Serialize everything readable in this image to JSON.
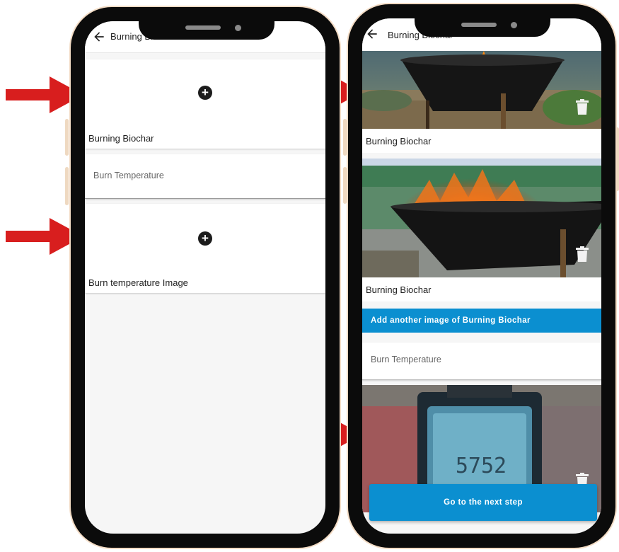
{
  "left_screen": {
    "appbar_title": "Burning Biochar",
    "upload_card_1_label": "Burning Biochar",
    "burn_temperature_placeholder": "Burn Temperature",
    "upload_card_2_label": "Burn temperature Image",
    "plus_glyph": "+"
  },
  "right_screen": {
    "appbar_title": "Burning Biochar",
    "photo_1_caption": "Burning Biochar",
    "photo_2_caption": "Burning Biochar",
    "add_another_label": "Add another image of Burning Biochar",
    "burn_temperature_placeholder": "Burn Temperature",
    "next_step_label": "Go to the next step"
  },
  "colors": {
    "arrow": "#d81e1e",
    "primary_button": "#0b8fd0",
    "phone_frame": "#0b0b0b",
    "phone_outline": "#f3dcc5"
  },
  "icons": [
    "arrow-back-icon",
    "add-circle-icon",
    "trash-icon",
    "red-pointer-arrow"
  ]
}
